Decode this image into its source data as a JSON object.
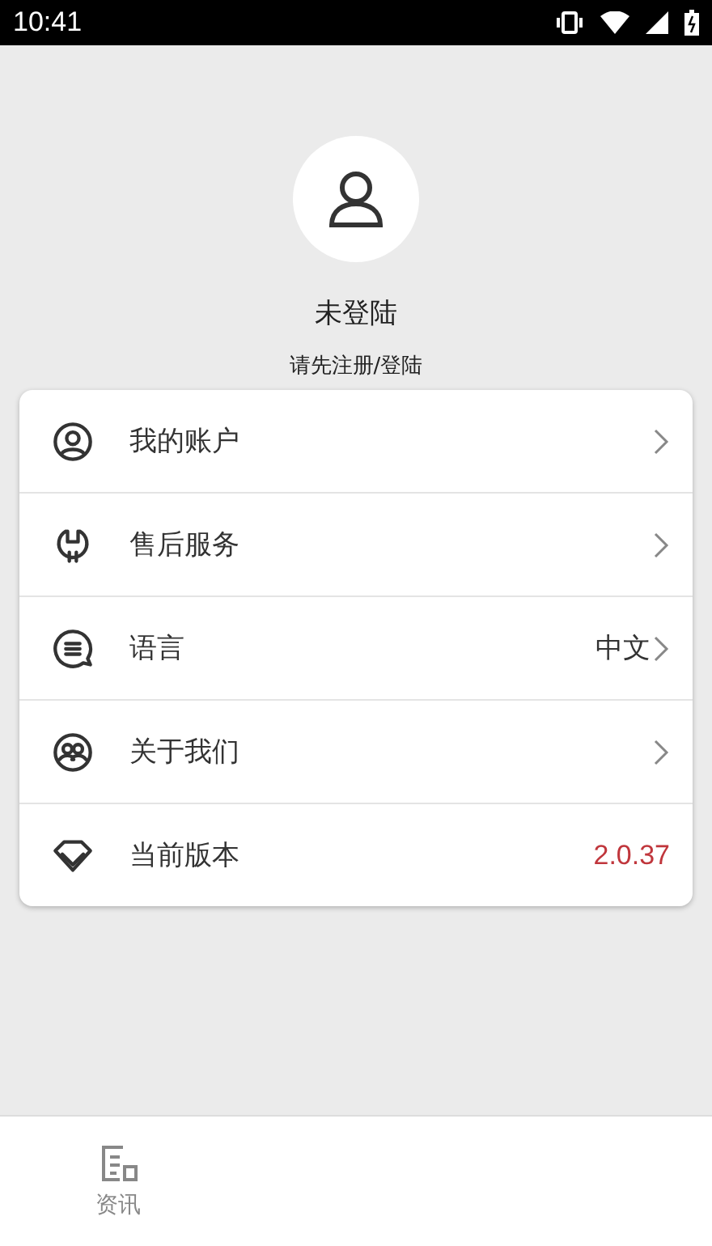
{
  "status_bar": {
    "time": "10:41"
  },
  "profile": {
    "name": "未登陆",
    "hint": "请先注册/登陆"
  },
  "menu": [
    {
      "kind": "link",
      "label": "我的账户"
    },
    {
      "kind": "link",
      "label": "售后服务"
    },
    {
      "kind": "link",
      "label": "语言",
      "value": "中文"
    },
    {
      "kind": "link",
      "label": "关于我们"
    },
    {
      "kind": "info",
      "label": "当前版本",
      "value": "2.0.37"
    }
  ],
  "bottom_nav": [
    {
      "label": "资讯",
      "selected": false
    }
  ]
}
